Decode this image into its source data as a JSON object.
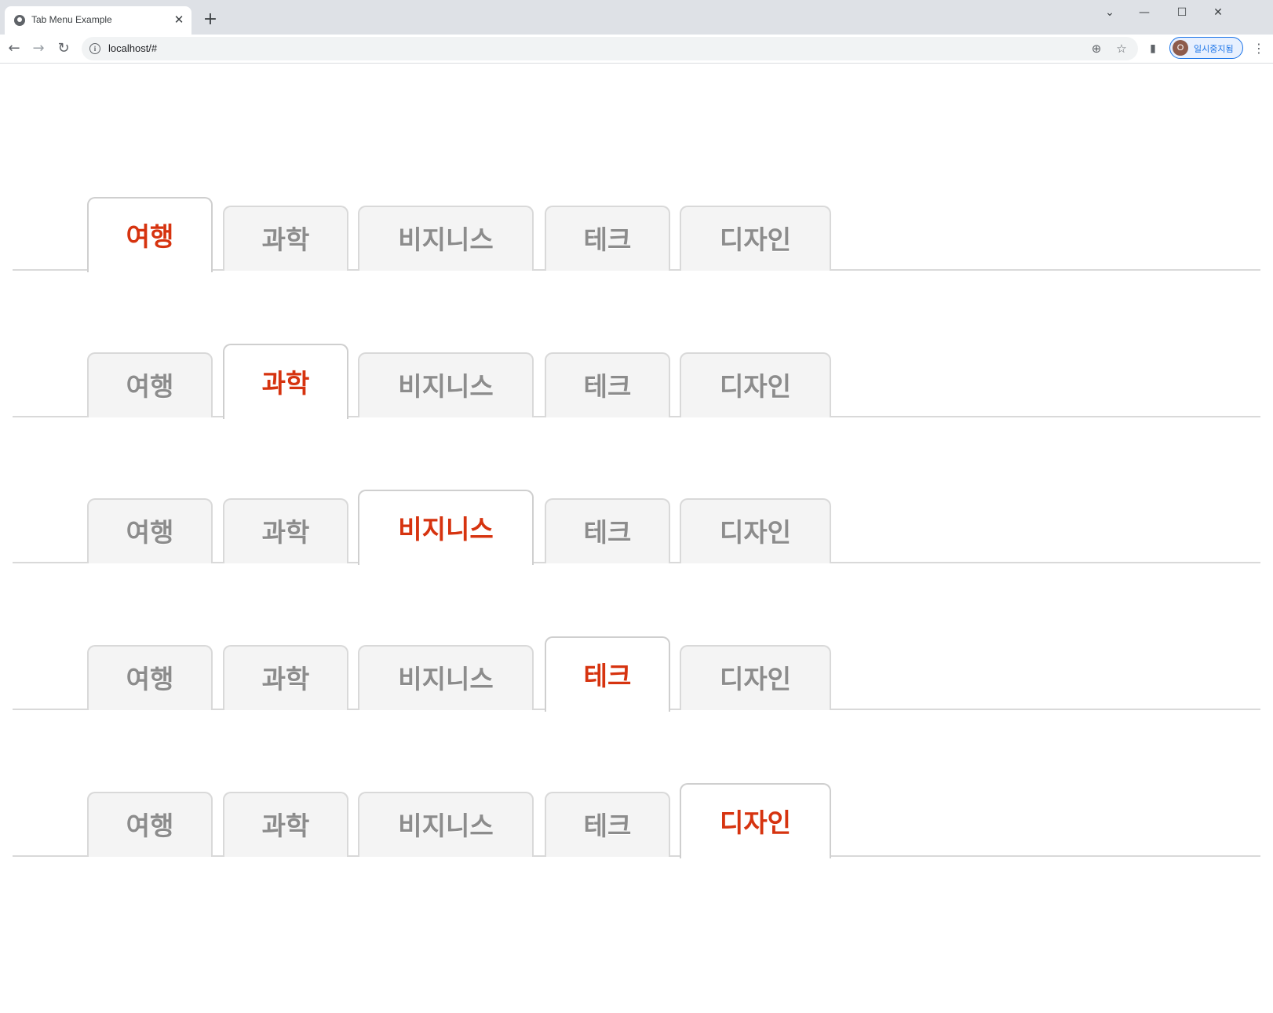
{
  "browser": {
    "tab_title": "Tab Menu Example",
    "tab_close": "✕",
    "new_tab": "+",
    "url": "localhost/#",
    "profile_initial": "O",
    "profile_label": "일시중지됨",
    "window_controls": {
      "tab_search": "⌄",
      "minimize": "—",
      "maximize": "☐",
      "close": "✕"
    },
    "icons": {
      "back": "arrow-left-icon",
      "forward": "arrow-right-icon",
      "reload": "reload-icon",
      "info": "info-icon",
      "zoom": "zoom-icon",
      "bookmark": "star-icon",
      "extensions": "puzzle-icon",
      "menu": "kebab-menu-icon"
    }
  },
  "tab_menus": [
    {
      "tabs": [
        "여행",
        "과학",
        "비지니스",
        "테크",
        "디자인"
      ],
      "active_index": 0
    },
    {
      "tabs": [
        "여행",
        "과학",
        "비지니스",
        "테크",
        "디자인"
      ],
      "active_index": 1
    },
    {
      "tabs": [
        "여행",
        "과학",
        "비지니스",
        "테크",
        "디자인"
      ],
      "active_index": 2
    },
    {
      "tabs": [
        "여행",
        "과학",
        "비지니스",
        "테크",
        "디자인"
      ],
      "active_index": 3
    },
    {
      "tabs": [
        "여행",
        "과학",
        "비지니스",
        "테크",
        "디자인"
      ],
      "active_index": 4
    }
  ],
  "colors": {
    "active_text": "#d6330f",
    "inactive_text": "#8c8c8c",
    "inactive_bg": "#f4f4f4",
    "border": "#d9d9d9"
  }
}
